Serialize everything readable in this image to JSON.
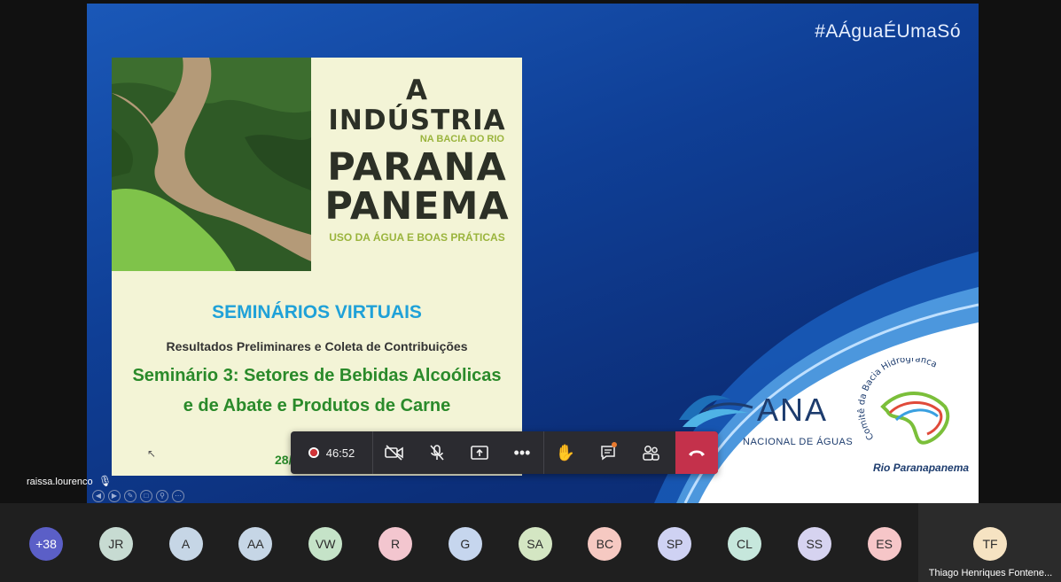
{
  "slide": {
    "hashtag": "#AÁguaÉUmaSó",
    "title_line1": "A INDÚSTRIA",
    "title_line2": "NA BACIA DO RIO",
    "title_line3": "PARANA",
    "title_line4": "PANEMA",
    "title_line5": "USO DA ÁGUA E BOAS PRÁTICAS",
    "seminar_title": "SEMINÁRIOS VIRTUAIS",
    "seminar_subtitle": "Resultados Preliminares e Coleta de Contribuições",
    "seminar_line1": "Seminário 3: Setores de Bebidas Alcoólicas",
    "seminar_line2": "e de Abate e Produtos de Carne",
    "date": "28/07/2020",
    "ana_logo": "ANA",
    "ana_sub": "NACIONAL DE ÁGUAS",
    "comite_arc": "Comitê da Bacia Hidrográfica",
    "comite_river": "Rio Paranapanema"
  },
  "presenter": {
    "name": "raissa.lourenco"
  },
  "toolbar": {
    "timer": "46:52",
    "icons": [
      "camera-off-icon",
      "mic-off-icon",
      "share-icon",
      "more-icon",
      "raise-hand-icon",
      "chat-icon",
      "participants-icon",
      "hangup-icon"
    ]
  },
  "participants": [
    {
      "initials": "+38",
      "color": "#5b5fc7"
    },
    {
      "initials": "JR",
      "color": "#c7dbd2"
    },
    {
      "initials": "A",
      "color": "#c6d6e6"
    },
    {
      "initials": "AA",
      "color": "#c6d6e6"
    },
    {
      "initials": "VW",
      "color": "#c5e3c8"
    },
    {
      "initials": "R",
      "color": "#f3c6cf"
    },
    {
      "initials": "G",
      "color": "#c6d6ee"
    },
    {
      "initials": "SA",
      "color": "#d4e6c3"
    },
    {
      "initials": "BC",
      "color": "#f6c9c2"
    },
    {
      "initials": "SP",
      "color": "#cfd2f3"
    },
    {
      "initials": "CL",
      "color": "#c6e7dc"
    },
    {
      "initials": "SS",
      "color": "#d6d3f0"
    },
    {
      "initials": "ES",
      "color": "#f6c6c8"
    }
  ],
  "active_speaker": {
    "initials": "TF",
    "color": "#f6e3c2",
    "name": "Thiago Henriques Fontene..."
  }
}
